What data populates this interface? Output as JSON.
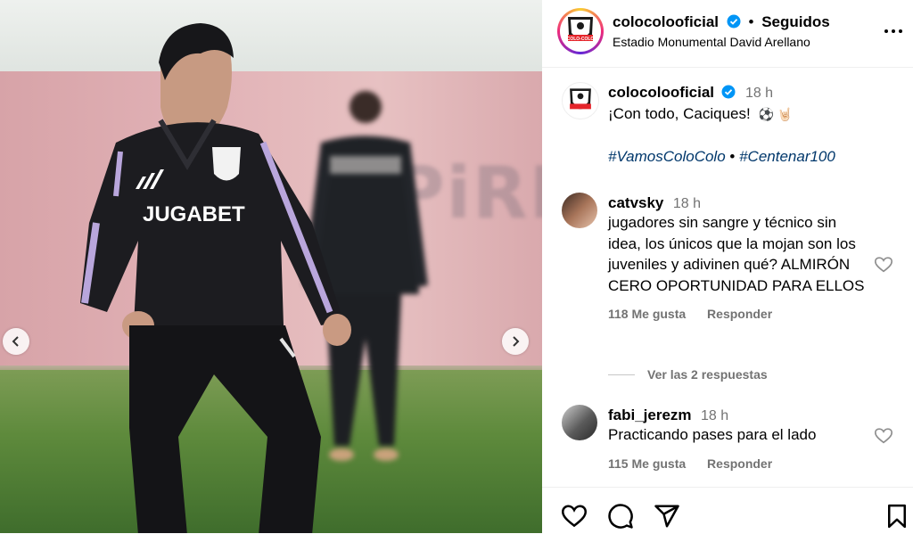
{
  "post": {
    "account": "colocolooficial",
    "follow_status": "Seguidos",
    "location": "Estadio Monumental David Arellano",
    "caption_time": "18 h",
    "caption_line1": "¡Con todo, Caciques!",
    "caption_emoji": "⚽ 🤘🏻",
    "hashtag1": "#VamosColoColo",
    "separator": "•",
    "hashtag2": "#Centenar100",
    "logo_text": "COLO-COLO",
    "photo_text": "JUGABET",
    "wall_text": "PiRI"
  },
  "comments": [
    {
      "user": "catvsky",
      "time": "18 h",
      "text": "jugadores sin sangre y técnico sin idea, los únicos que la mojan son los juveniles y adivinen qué? ALMIRÓN CERO OPORTUNIDAD PARA ELLOS",
      "likes": "118 Me gusta",
      "reply": "Responder",
      "view_replies": "Ver las 2 respuestas"
    },
    {
      "user": "fabi_jerezm",
      "time": "18 h",
      "text": "Practicando pases para el lado",
      "likes": "115 Me gusta",
      "reply": "Responder"
    }
  ],
  "icons": {
    "verified": "verified-badge-icon",
    "more": "more-options-icon",
    "like": "heart-icon",
    "comment": "comment-icon",
    "share": "share-icon",
    "save": "bookmark-icon",
    "prev": "chevron-left-icon",
    "next": "chevron-right-icon"
  },
  "colors": {
    "verified": "#0095f6",
    "meta_text": "#737373",
    "hashtag": "#00376b"
  }
}
